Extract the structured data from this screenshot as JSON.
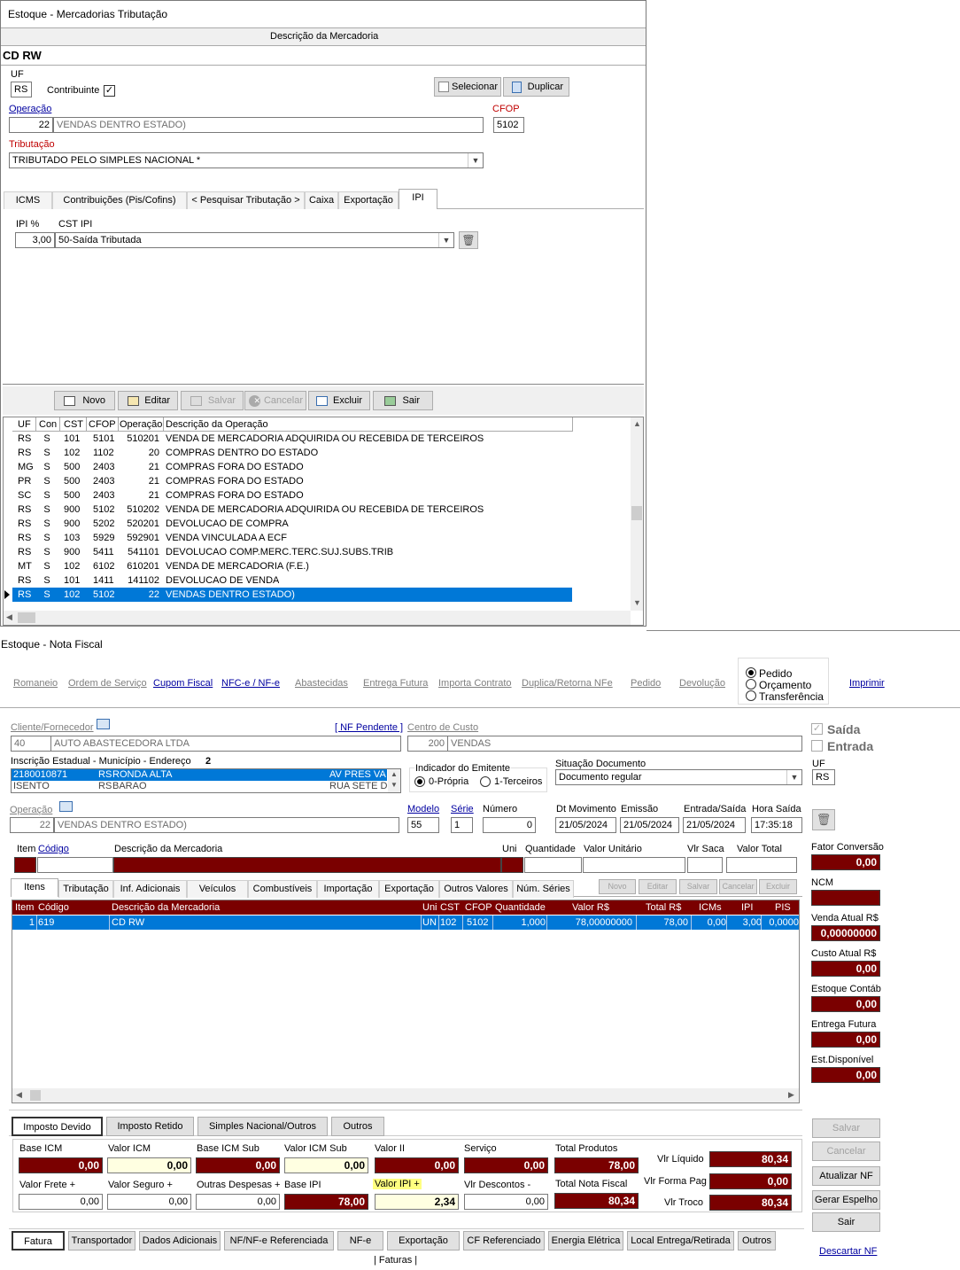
{
  "win1": {
    "title": "Estoque - Mercadorias Tributação",
    "header": "Descrição da Mercadoria",
    "product": "CD RW",
    "uf_label": "UF",
    "uf_value": "RS",
    "contrib_label": "Contribuinte",
    "contrib_check": "✓",
    "selecionar": "Selecionar",
    "duplicar": "Duplicar",
    "operacao_label": "Operação",
    "operacao_code": "22",
    "operacao_desc": "VENDAS DENTRO ESTADO)",
    "cfop_label": "CFOP",
    "cfop_value": "5102",
    "tributacao_label": "Tributação",
    "tributacao_value": "TRIBUTADO PELO SIMPLES NACIONAL *",
    "tabs": [
      "ICMS",
      "Contribuições (Pis/Cofins)",
      "< Pesquisar Tributação >",
      "Caixa",
      "Exportação",
      "IPI"
    ],
    "ipi_label": "IPI %",
    "cst_ipi_label": "CST IPI",
    "ipi_value": "3,00",
    "cst_ipi_value": "50-Saída Tributada",
    "toolbar": {
      "novo": "Novo",
      "editar": "Editar",
      "salvar": "Salvar",
      "cancelar": "Cancelar",
      "excluir": "Excluir",
      "sair": "Sair"
    },
    "grid_headers": [
      "UF",
      "Con",
      "CST",
      "CFOP",
      "Operação",
      "Descrição da Operação"
    ],
    "rows": [
      [
        "RS",
        "S",
        "101",
        "5101",
        "510201",
        "VENDA DE MERCADORIA ADQUIRIDA OU RECEBIDA DE TERCEIROS"
      ],
      [
        "RS",
        "S",
        "102",
        "1102",
        "20",
        "COMPRAS DENTRO DO ESTADO"
      ],
      [
        "MG",
        "S",
        "500",
        "2403",
        "21",
        "COMPRAS FORA DO ESTADO"
      ],
      [
        "PR",
        "S",
        "500",
        "2403",
        "21",
        "COMPRAS FORA DO ESTADO"
      ],
      [
        "SC",
        "S",
        "500",
        "2403",
        "21",
        "COMPRAS FORA DO ESTADO"
      ],
      [
        "RS",
        "S",
        "900",
        "5102",
        "510202",
        "VENDA DE MERCADORIA ADQUIRIDA OU RECEBIDA DE TERCEIROS"
      ],
      [
        "RS",
        "S",
        "900",
        "5202",
        "520201",
        "DEVOLUCAO DE COMPRA"
      ],
      [
        "RS",
        "S",
        "103",
        "5929",
        "592901",
        "VENDA VINCULADA A ECF"
      ],
      [
        "RS",
        "S",
        "900",
        "5411",
        "541101",
        "DEVOLUCAO COMP.MERC.TERC.SUJ.SUBS.TRIB"
      ],
      [
        "MT",
        "S",
        "102",
        "6102",
        "610201",
        "VENDA DE MERCADORIA (F.E.)"
      ],
      [
        "RS",
        "S",
        "101",
        "1411",
        "141102",
        "DEVOLUCAO DE VENDA"
      ],
      [
        "RS",
        "S",
        "102",
        "5102",
        "22",
        "VENDAS DENTRO ESTADO)"
      ]
    ]
  },
  "win2": {
    "title": "Estoque - Nota Fiscal",
    "links": [
      "Romaneio",
      "Ordem de Serviço",
      "Cupom Fiscal",
      "NFC-e / NF-e",
      "Abastecidas",
      "Entrega Futura",
      "Importa Contrato",
      "Duplica/Retorna NFe",
      "Pedido",
      "Devolução"
    ],
    "radio_pedido": "Pedido",
    "radio_orcamento": "Orçamento",
    "radio_transferencia": "Transferência",
    "imprimir": "Imprimir",
    "cliente_label": "Cliente/Fornecedor",
    "nf_pendente": "[ NF Pendente ]",
    "cliente_code": "40",
    "cliente_name": "AUTO ABASTECEDORA LTDA",
    "centro_label": "Centro de Custo",
    "centro_code": "200",
    "centro_name": "VENDAS",
    "saida": "Saída",
    "entrada": "Entrada",
    "ie_label": "Inscrição Estadual - Município - Endereço",
    "ie_count": "2",
    "ie_rows": [
      [
        "2180010871",
        "RS",
        "RONDA ALTA",
        "AV PRES VA"
      ],
      [
        "ISENTO",
        "RS",
        "BARAO",
        "RUA SETE D"
      ]
    ],
    "indicador_label": "Indicador do Emitente",
    "ind_propria": "0-Própria",
    "ind_terceiros": "1-Terceiros",
    "situacao_label": "Situação Documento",
    "situacao_value": "Documento regular",
    "uf_label": "UF",
    "uf_value": "RS",
    "operacao_label": "Operação",
    "operacao_code": "22",
    "operacao_desc": "VENDAS DENTRO ESTADO)",
    "modelo_label": "Modelo",
    "modelo_value": "55",
    "serie_label": "Série",
    "serie_value": "1",
    "numero_label": "Número",
    "numero_value": "0",
    "dtmov_label": "Dt Movimento",
    "dtmov_value": "21/05/2024",
    "emissao_label": "Emissão",
    "emissao_value": "21/05/2024",
    "entsai_label": "Entrada/Saída",
    "entsai_value": "21/05/2024",
    "hora_label": "Hora Saída",
    "hora_value": "17:35:18",
    "item_labels": [
      "Item",
      "Código",
      "Descrição da Mercadoria",
      "Uni",
      "Quantidade",
      "Valor Unitário",
      "Vlr Saca",
      "Valor Total"
    ],
    "tabs": [
      "Itens",
      "Tributação",
      "Inf. Adicionais",
      "Veículos",
      "Combustíveis",
      "Importação",
      "Exportação",
      "Outros Valores",
      "Núm. Séries"
    ],
    "mini_btns": [
      "Novo",
      "Editar",
      "Salvar",
      "Cancelar",
      "Excluir"
    ],
    "items_headers": [
      "Item",
      "Código",
      "Descrição da Mercadoria",
      "Uni",
      "CST",
      "CFOP",
      "Quantidade",
      "Valor R$",
      "Total R$",
      "ICMs",
      "IPI",
      "PIS"
    ],
    "items_row": [
      "1",
      "619",
      "CD RW",
      "UN",
      "102",
      "5102",
      "1,000",
      "78,00000000",
      "78,00",
      "0,00",
      "3,00",
      "0,0000"
    ],
    "side": [
      {
        "label": "Fator Conversão",
        "value": "0,00"
      },
      {
        "label": "NCM",
        "value": ""
      },
      {
        "label": "Venda Atual R$",
        "value": "0,00000000"
      },
      {
        "label": "Custo Atual R$",
        "value": "0,00"
      },
      {
        "label": "Estoque Contáb",
        "value": "0,00"
      },
      {
        "label": "Entrega Futura",
        "value": "0,00"
      },
      {
        "label": "Est.Disponível",
        "value": "0,00"
      }
    ],
    "imp_tabs": [
      "Imposto Devido",
      "Imposto Retido",
      "Simples Nacional/Outros",
      "Outros"
    ],
    "base_icm_label": "Base ICM",
    "base_icm": "0,00",
    "valor_icm_label": "Valor ICM",
    "valor_icm": "0,00",
    "base_icm_sub_label": "Base ICM Sub",
    "base_icm_sub": "0,00",
    "valor_icm_sub_label": "Valor ICM Sub",
    "valor_icm_sub": "0,00",
    "valor_ii_label": "Valor II",
    "valor_ii": "0,00",
    "servico_label": "Serviço",
    "servico": "0,00",
    "total_produtos_label": "Total Produtos",
    "total_produtos": "78,00",
    "vlr_liquido_label": "Vlr Líquido",
    "vlr_liquido": "80,34",
    "valor_frete_label": "Valor Frete +",
    "valor_frete": "0,00",
    "valor_seguro_label": "Valor Seguro +",
    "valor_seguro": "0,00",
    "outras_desp_label": "Outras Despesas +",
    "outras_desp": "0,00",
    "base_ipi_label": "Base IPI",
    "base_ipi": "78,00",
    "valor_ipi_label": "Valor IPI +",
    "valor_ipi": "2,34",
    "vlr_desc_label": "Vlr Descontos -",
    "vlr_desc": "0,00",
    "total_nf_label": "Total Nota Fiscal",
    "total_nf": "80,34",
    "vlr_forma_label": "Vlr Forma Pag",
    "vlr_forma": "0,00",
    "vlr_troco_label": "Vlr Troco",
    "vlr_troco": "80,34",
    "action_btns": [
      "Salvar",
      "Cancelar",
      "Atualizar NF",
      "Gerar Espelho",
      "Sair"
    ],
    "bottom_tabs": [
      "Fatura",
      "Transportador",
      "Dados Adicionais",
      "NF/NF-e Referenciada",
      "NF-e",
      "Exportação",
      "CF Referenciado",
      "Energia Elétrica",
      "Local Entrega/Retirada",
      "Outros"
    ],
    "faturas": "| Faturas |",
    "descartar": "Descartar NF"
  }
}
